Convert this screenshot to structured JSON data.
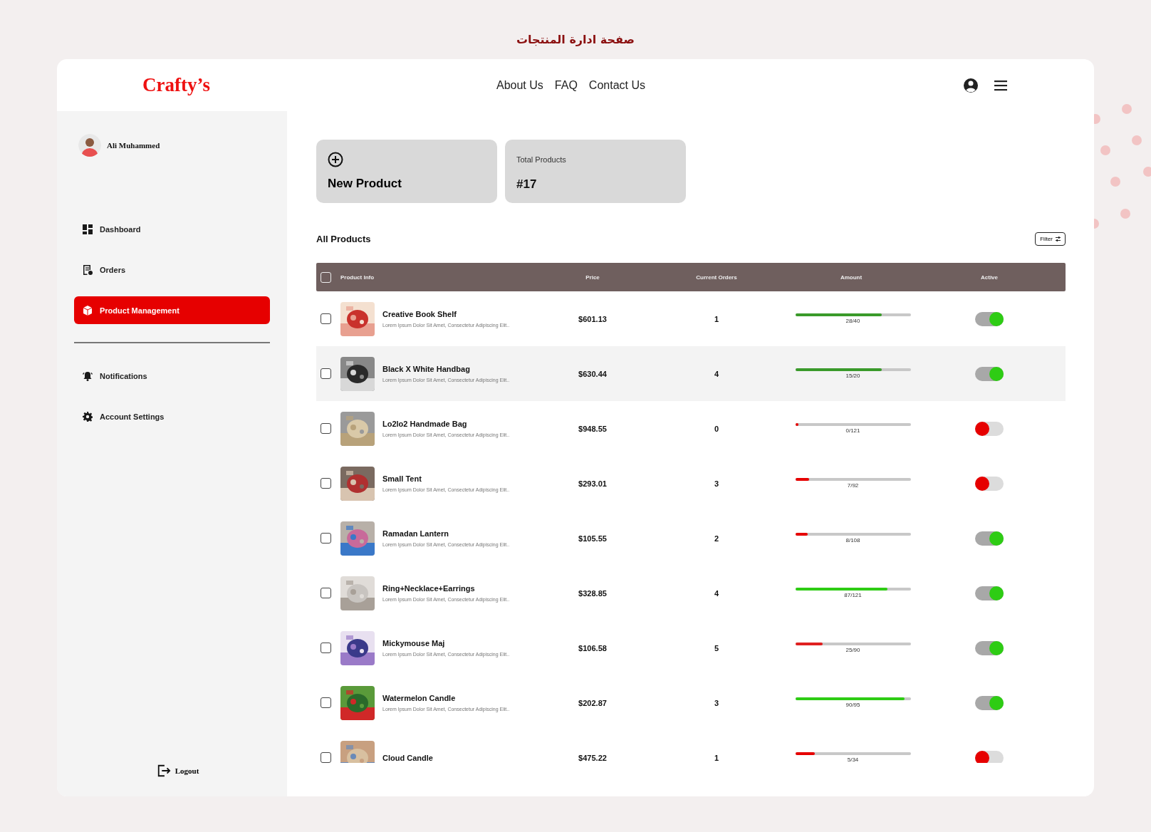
{
  "page_title": "صفحة ادارة المنتجات",
  "header": {
    "logo": "Crafty’s",
    "nav": [
      "About Us",
      "FAQ",
      "Contact Us"
    ]
  },
  "sidebar": {
    "user": "Ali Muhammed",
    "items": [
      {
        "label": "Dashboard",
        "selected": false
      },
      {
        "label": "Orders",
        "selected": false
      },
      {
        "label": "Product Management",
        "selected": true
      }
    ],
    "items_2": [
      {
        "label": "Notifications",
        "selected": false
      },
      {
        "label": "Account Settings",
        "selected": false
      }
    ],
    "logout": "Logout"
  },
  "cards": {
    "new_product": "New Product",
    "total_label": "Total Products",
    "total_value": "#17"
  },
  "section_title": "All Products",
  "filter": "Filter",
  "table": {
    "header_checked": false,
    "columns": [
      "Product Info",
      "Price",
      "Current Orders",
      "Amount",
      "Active"
    ],
    "rows": [
      {
        "name": "Creative Book Shelf",
        "description": "Lorem Ipsum Dolor Sit Amet, Consectetur Adipiscing Elit..",
        "price": "$601.13",
        "orders": "1",
        "level": 0.75,
        "color": "#3a9a2a",
        "amount": "28/40",
        "active": true,
        "checked": false,
        "selected": false
      },
      {
        "name": "Black X White Handbag",
        "description": "Lorem Ipsum Dolor Sit Amet, Consectetur Adipiscing Elit..",
        "price": "$630.44",
        "orders": "4",
        "level": 0.75,
        "color": "#3a9a2a",
        "amount": "15/20",
        "active": true,
        "checked": false,
        "selected": true
      },
      {
        "name": "Lo2lo2 Handmade Bag",
        "description": "Lorem Ipsum Dolor Sit Amet, Consectetur Adipiscing Elit..",
        "price": "$948.55",
        "orders": "0",
        "level": 0.03,
        "color": "#e60000",
        "amount": "0/121",
        "active": false,
        "checked": false,
        "selected": false
      },
      {
        "name": "Small Tent",
        "description": "Lorem Ipsum Dolor Sit Amet, Consectetur Adipiscing Elit..",
        "price": "$293.01",
        "orders": "3",
        "level": 0.12,
        "color": "#e60000",
        "amount": "7/92",
        "active": false,
        "checked": false,
        "selected": false
      },
      {
        "name": "Ramadan Lantern",
        "description": "Lorem Ipsum Dolor Sit Amet, Consectetur Adipiscing Elit..",
        "price": "$105.55",
        "orders": "2",
        "level": 0.11,
        "color": "#e60000",
        "amount": "8/108",
        "active": true,
        "checked": false,
        "selected": false
      },
      {
        "name": "Ring+Necklace+Earrings",
        "description": "Lorem Ipsum Dolor Sit Amet, Consectetur Adipiscing Elit..",
        "price": "$328.85",
        "orders": "4",
        "level": 0.8,
        "color": "#2ecc14",
        "amount": "87/121",
        "active": true,
        "checked": false,
        "selected": false
      },
      {
        "name": "Mickymouse Maj",
        "description": "Lorem Ipsum Dolor Sit Amet, Consectetur Adipiscing Elit..",
        "price": "$106.58",
        "orders": "5",
        "level": 0.24,
        "color": "#e02020",
        "amount": "25/90",
        "active": true,
        "checked": false,
        "selected": false
      },
      {
        "name": "Watermelon Candle",
        "description": "Lorem Ipsum Dolor Sit Amet, Consectetur Adipiscing Elit..",
        "price": "$202.87",
        "orders": "3",
        "level": 0.95,
        "color": "#2ecc14",
        "amount": "90/95",
        "active": true,
        "checked": false,
        "selected": false
      },
      {
        "name": "Cloud Candle",
        "price": "$475.22",
        "orders": "1",
        "level": 0.17,
        "color": "#e60000",
        "amount": "5/34",
        "active": false,
        "checked": false,
        "selected": false
      }
    ]
  }
}
